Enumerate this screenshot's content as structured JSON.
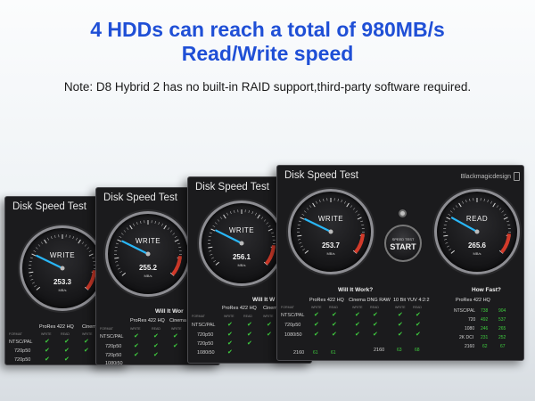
{
  "headline": {
    "line1": "4 HDDs can reach a total of 980MB/s",
    "line2": "Read/Write speed"
  },
  "note": "Note: D8 Hybrid 2 has no built-in RAID support,third-party software required.",
  "panel_title": "Disk Speed Test",
  "brand": "Blackmagicdesign",
  "unit": "MB/s",
  "write_label": "WRITE",
  "read_label": "READ",
  "panels": [
    {
      "write_value": "253.3",
      "write_level": 0.2533
    },
    {
      "write_value": "255.2",
      "write_level": 0.2552
    },
    {
      "write_value": "256.1",
      "write_level": 0.2561
    },
    {
      "write_value": "253.7",
      "write_level": 0.2537,
      "read_value": "265.6",
      "read_level": 0.2656
    }
  ],
  "will_it_work": "Will It Work?",
  "will_it_work_cut": "Will It Wor",
  "will_it_work_cut2": "Will It W",
  "how_fast": "How Fast?",
  "formats": [
    "ProRes 422 HQ",
    "Cinema DNG RAW",
    "10 Bit YUV 4:2:2"
  ],
  "format_cut": "Cinema",
  "format_cut2": "Cinem",
  "format_col": "FORMAT",
  "write_col": "WRITE",
  "read_col": "READ",
  "rows": [
    "NTSC/PAL",
    "720p50",
    "1080i50",
    "2160"
  ],
  "rows_short": [
    "NTSC/PAL",
    "720p50",
    "720p50",
    "1080i50"
  ],
  "last_row_nums": [
    "61",
    "61",
    "63",
    "68"
  ],
  "start_top": "SPEED TEST",
  "start_bottom": "START",
  "how_fast_rows": [
    {
      "label": "NTSC/PAL",
      "w": "738",
      "r": "904"
    },
    {
      "label": "720",
      "w": "492",
      "r": "537"
    },
    {
      "label": "1080",
      "w": "246",
      "r": "265"
    },
    {
      "label": "2K DCI",
      "w": "231",
      "r": "252"
    },
    {
      "label": "2160",
      "w": "62",
      "r": "67"
    }
  ],
  "colors": {
    "headline": "#1f4fd6",
    "needle": "#29b6f6",
    "check": "#3fcf3f",
    "redzone": "#d23a2a"
  }
}
